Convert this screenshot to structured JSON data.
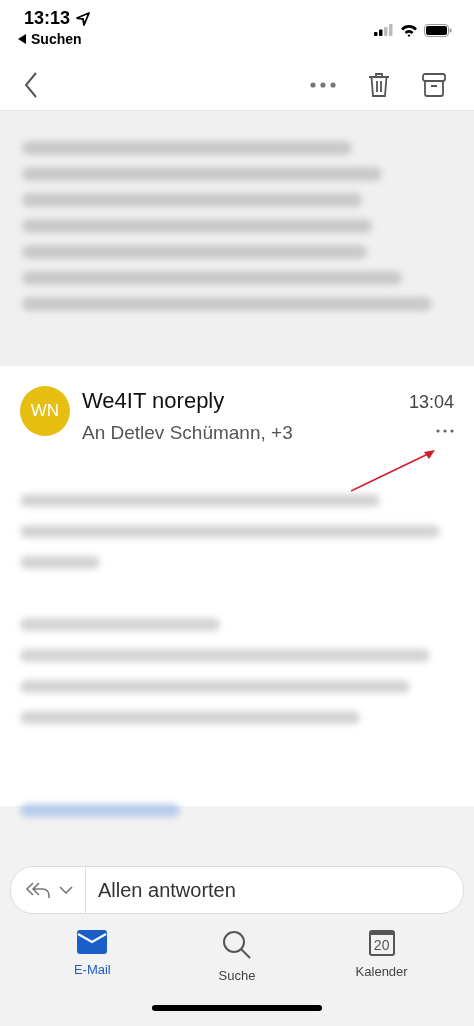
{
  "status_bar": {
    "time": "13:13",
    "back_label": "Suchen"
  },
  "message": {
    "avatar_initials": "WN",
    "sender": "We4IT noreply",
    "recipients": "An Detlev Schümann, +3",
    "time": "13:04"
  },
  "reply": {
    "label": "Allen antworten"
  },
  "tabs": [
    {
      "label": "E-Mail",
      "kind": "mail",
      "selected": true
    },
    {
      "label": "Suche",
      "kind": "search",
      "selected": false
    },
    {
      "label": "Kalender",
      "kind": "calendar",
      "selected": false,
      "day": "20"
    }
  ]
}
